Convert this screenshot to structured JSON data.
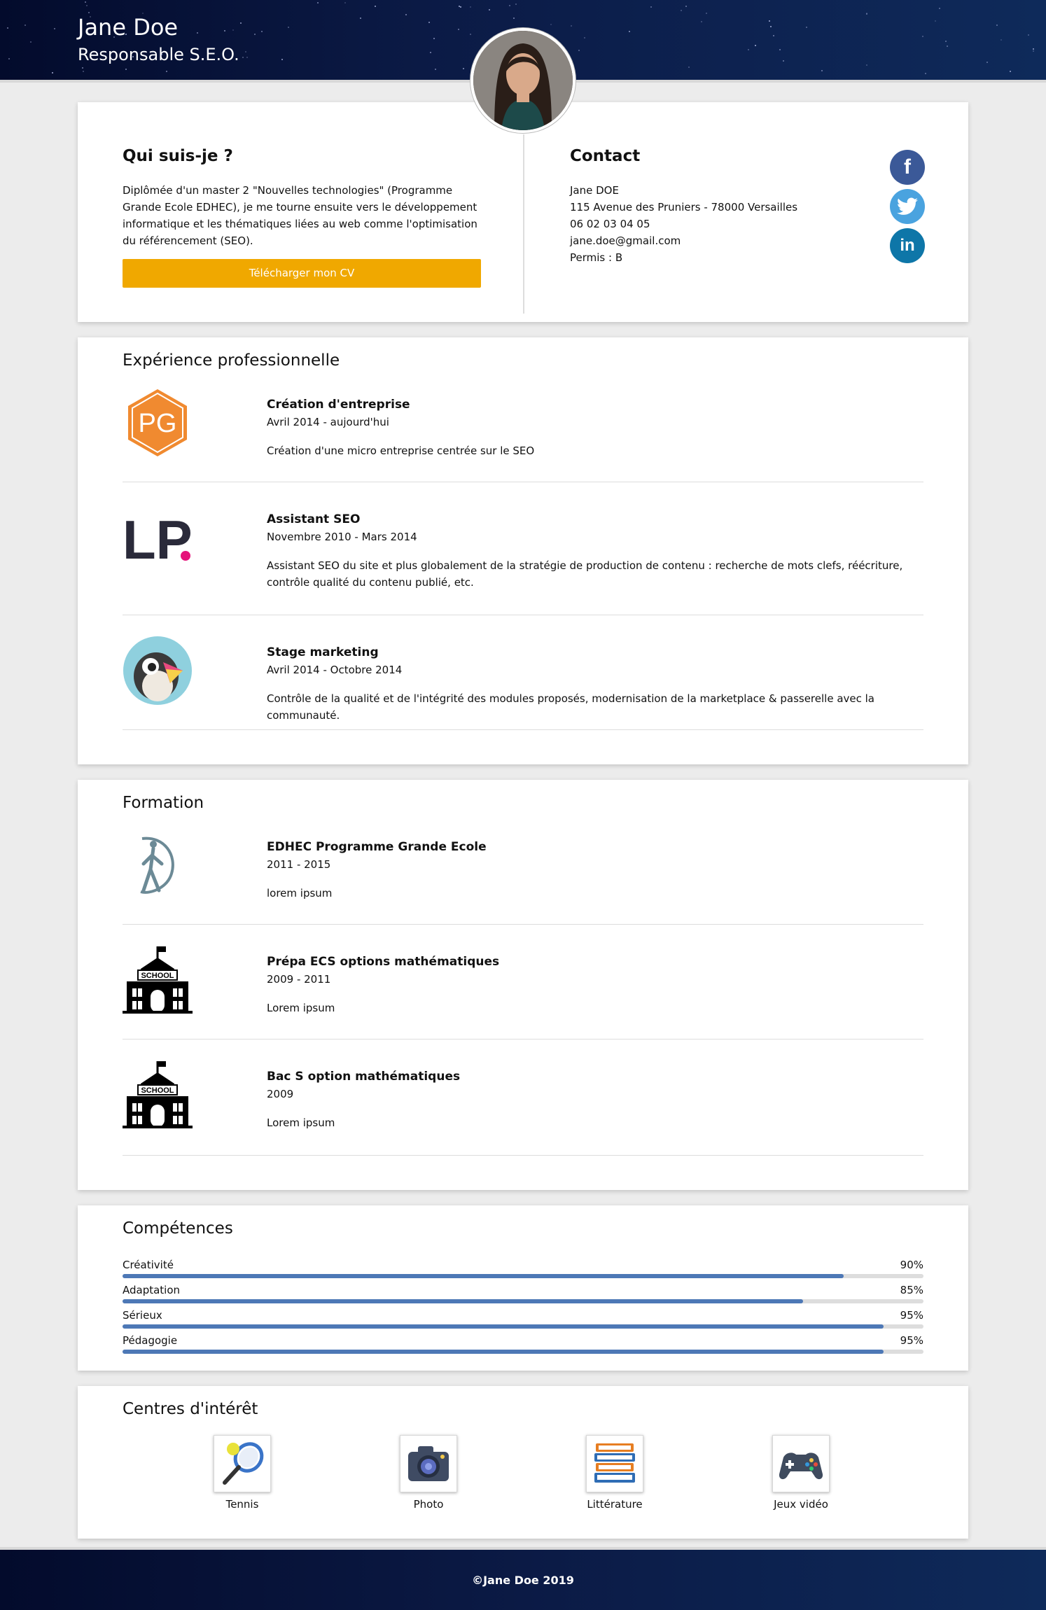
{
  "header": {
    "name": "Jane Doe",
    "job_title": "Responsable S.E.O."
  },
  "about": {
    "title": "Qui suis-je ?",
    "text": "Diplômée d'un master 2 \"Nouvelles technologies\" (Programme Grande Ecole EDHEC), je me tourne ensuite vers le développement informatique et les thématiques liées au web comme l'optimisation du référencement (SEO).",
    "cv_button": "Télécharger mon CV"
  },
  "contact": {
    "title": "Contact",
    "lines": [
      "Jane DOE",
      "115 Avenue des Pruniers - 78000 Versailles",
      "06 02 03 04 05",
      "jane.doe@gmail.com",
      "Permis : B"
    ],
    "social": [
      {
        "icon": "facebook-icon",
        "glyph": "f",
        "color": "#3b5998"
      },
      {
        "icon": "twitter-icon",
        "glyph": "t",
        "color": "#4aa3df"
      },
      {
        "icon": "linkedin-icon",
        "glyph": "in",
        "color": "#0e76a8"
      }
    ]
  },
  "experience": {
    "title": "Expérience professionnelle",
    "items": [
      {
        "logo": "pg-logo",
        "logo_text": "PG",
        "title": "Création d'entreprise",
        "dates": "Avril 2014 - aujourd'hui",
        "desc": "Création d'une micro entreprise centrée sur le SEO"
      },
      {
        "logo": "lp-logo",
        "logo_text": "LP",
        "title": "Assistant SEO",
        "dates": "Novembre 2010 - Mars 2014",
        "desc": "Assistant SEO du site et plus globalement de la stratégie de production de contenu : recherche de mots clefs, réécriture, contrôle qualité du contenu publié, etc."
      },
      {
        "logo": "prestashop-puffin-logo",
        "logo_text": "",
        "title": "Stage marketing",
        "dates": "Avril 2014 - Octobre 2014",
        "desc": "Contrôle de la qualité et de l'intégrité des modules proposés, modernisation de la marketplace & passerelle avec la communauté."
      }
    ]
  },
  "education": {
    "title": "Formation",
    "items": [
      {
        "logo": "edhec-logo",
        "logo_text": "",
        "title": "EDHEC Programme Grande Ecole",
        "dates": "2011 - 2015",
        "desc": "lorem ipsum"
      },
      {
        "logo": "school-logo",
        "logo_text": "SCHOOL",
        "title": "Prépa ECS options mathématiques",
        "dates": "2009 - 2011",
        "desc": "Lorem ipsum"
      },
      {
        "logo": "school-logo",
        "logo_text": "SCHOOL",
        "title": "Bac S option mathématiques",
        "dates": "2009",
        "desc": "Lorem ipsum"
      }
    ]
  },
  "skills": {
    "title": "Compétences",
    "items": [
      {
        "label": "Créativité",
        "percent": "90%",
        "value": 0.9
      },
      {
        "label": "Adaptation",
        "percent": "85%",
        "value": 0.85
      },
      {
        "label": "Sérieux",
        "percent": "95%",
        "value": 0.95
      },
      {
        "label": "Pédagogie",
        "percent": "95%",
        "value": 0.95
      }
    ]
  },
  "hobbies": {
    "title": "Centres d'intérêt",
    "items": [
      {
        "label": "Tennis",
        "icon": "tennis-racket-icon"
      },
      {
        "label": "Photo",
        "icon": "camera-icon"
      },
      {
        "label": "Littérature",
        "icon": "books-icon"
      },
      {
        "label": "Jeux vidéo",
        "icon": "gamepad-icon"
      }
    ]
  },
  "footer": {
    "copyright": "©Jane Doe 2019"
  },
  "colors": {
    "accent_button": "#f0a800",
    "skill_bar": "#4d78b6",
    "header_bg": "#0b1a45"
  }
}
